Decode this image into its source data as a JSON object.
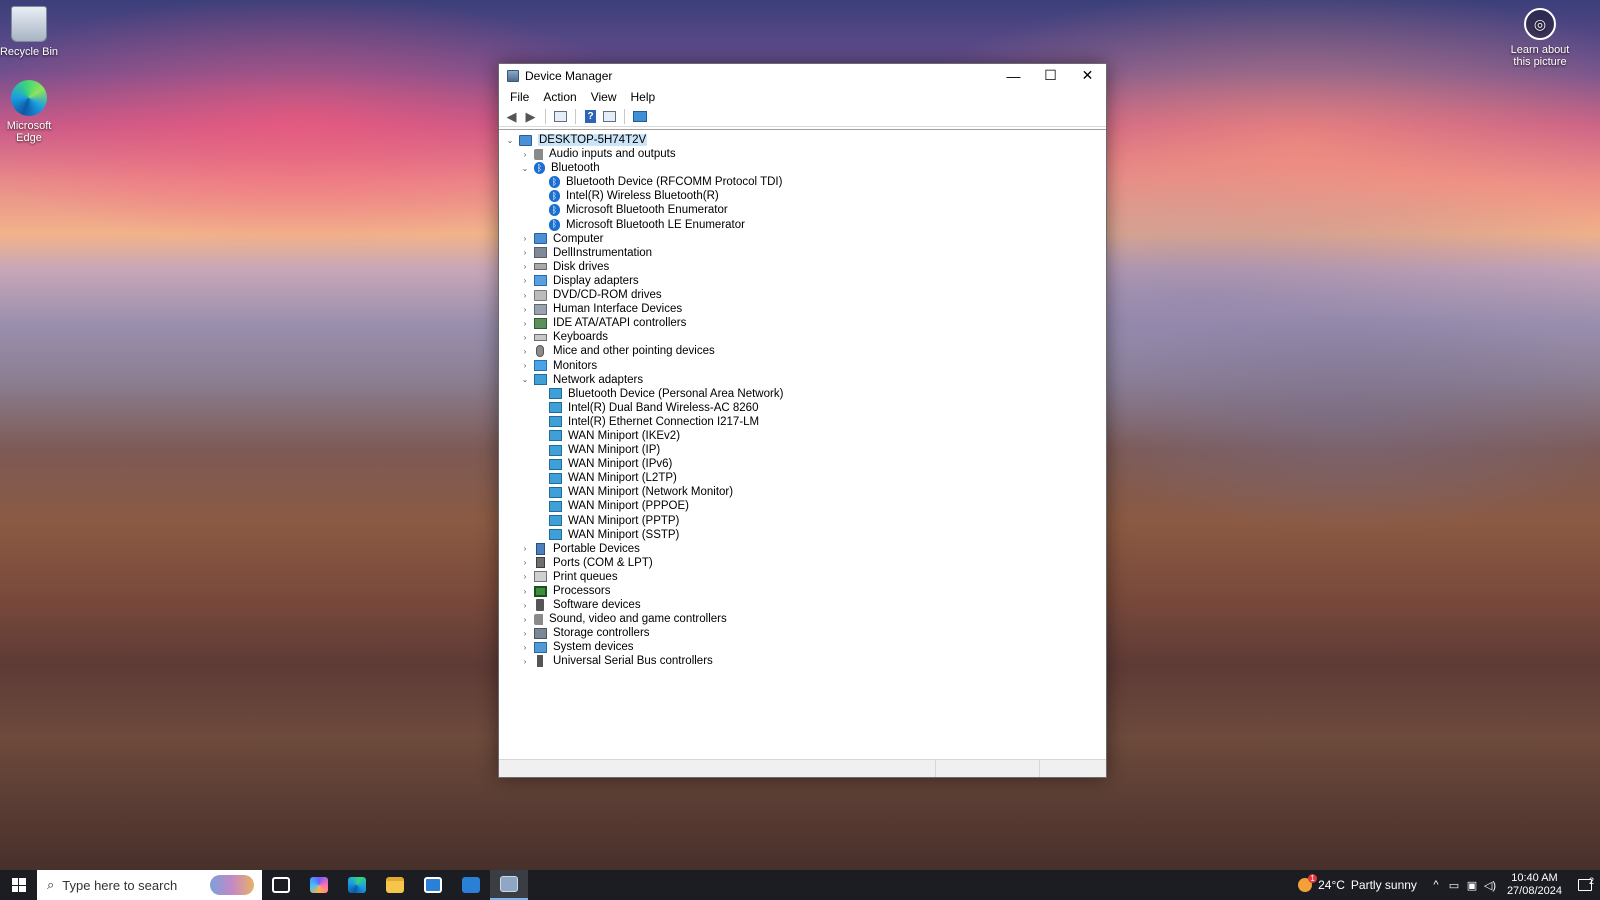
{
  "desktop": {
    "icons": [
      {
        "label": "Recycle Bin"
      },
      {
        "label": "Microsoft Edge"
      }
    ],
    "spotlight_label": "Learn about this picture"
  },
  "window": {
    "title": "Device Manager",
    "controls": {
      "minimize": "—",
      "maximize": "☐",
      "close": "✕"
    },
    "menu": [
      "File",
      "Action",
      "View",
      "Help"
    ],
    "toolbar": {
      "back": "back-arrow-icon",
      "forward": "forward-arrow-icon",
      "properties": "properties-icon",
      "help": "help-icon",
      "view": "view-icon",
      "monitor": "monitor-icon",
      "help_glyph": "?"
    },
    "tree": {
      "root": "DESKTOP-5H74T2V",
      "categories": [
        {
          "label": "Audio inputs and outputs",
          "expanded": false,
          "icon": "audio"
        },
        {
          "label": "Bluetooth",
          "expanded": true,
          "icon": "bt",
          "children": [
            "Bluetooth Device (RFCOMM Protocol TDI)",
            "Intel(R) Wireless Bluetooth(R)",
            "Microsoft Bluetooth Enumerator",
            "Microsoft Bluetooth LE Enumerator"
          ]
        },
        {
          "label": "Computer",
          "expanded": false,
          "icon": "computer"
        },
        {
          "label": "DellInstrumentation",
          "expanded": false,
          "icon": "generic"
        },
        {
          "label": "Disk drives",
          "expanded": false,
          "icon": "disk"
        },
        {
          "label": "Display adapters",
          "expanded": false,
          "icon": "display"
        },
        {
          "label": "DVD/CD-ROM drives",
          "expanded": false,
          "icon": "dvd"
        },
        {
          "label": "Human Interface Devices",
          "expanded": false,
          "icon": "hid"
        },
        {
          "label": "IDE ATA/ATAPI controllers",
          "expanded": false,
          "icon": "ide"
        },
        {
          "label": "Keyboards",
          "expanded": false,
          "icon": "keyboard"
        },
        {
          "label": "Mice and other pointing devices",
          "expanded": false,
          "icon": "mouse"
        },
        {
          "label": "Monitors",
          "expanded": false,
          "icon": "monitor"
        },
        {
          "label": "Network adapters",
          "expanded": true,
          "icon": "net",
          "children": [
            "Bluetooth Device (Personal Area Network)",
            "Intel(R) Dual Band Wireless-AC 8260",
            "Intel(R) Ethernet Connection I217-LM",
            "WAN Miniport (IKEv2)",
            "WAN Miniport (IP)",
            "WAN Miniport (IPv6)",
            "WAN Miniport (L2TP)",
            "WAN Miniport (Network Monitor)",
            "WAN Miniport (PPPOE)",
            "WAN Miniport (PPTP)",
            "WAN Miniport (SSTP)"
          ]
        },
        {
          "label": "Portable Devices",
          "expanded": false,
          "icon": "portable"
        },
        {
          "label": "Ports (COM & LPT)",
          "expanded": false,
          "icon": "ports"
        },
        {
          "label": "Print queues",
          "expanded": false,
          "icon": "print"
        },
        {
          "label": "Processors",
          "expanded": false,
          "icon": "proc"
        },
        {
          "label": "Software devices",
          "expanded": false,
          "icon": "sw"
        },
        {
          "label": "Sound, video and game controllers",
          "expanded": false,
          "icon": "sound"
        },
        {
          "label": "Storage controllers",
          "expanded": false,
          "icon": "storage"
        },
        {
          "label": "System devices",
          "expanded": false,
          "icon": "sys"
        },
        {
          "label": "Universal Serial Bus controllers",
          "expanded": false,
          "icon": "usb"
        }
      ]
    }
  },
  "taskbar": {
    "search_placeholder": "Type here to search",
    "apps": [
      "task-view",
      "copilot",
      "edge",
      "file-explorer",
      "microsoft-store",
      "mail",
      "device-manager"
    ],
    "weather": {
      "temp": "24°C",
      "condition": "Partly sunny",
      "badge": "1"
    },
    "clock": {
      "time": "10:40 AM",
      "date": "27/08/2024"
    },
    "notifications_count": "2"
  }
}
